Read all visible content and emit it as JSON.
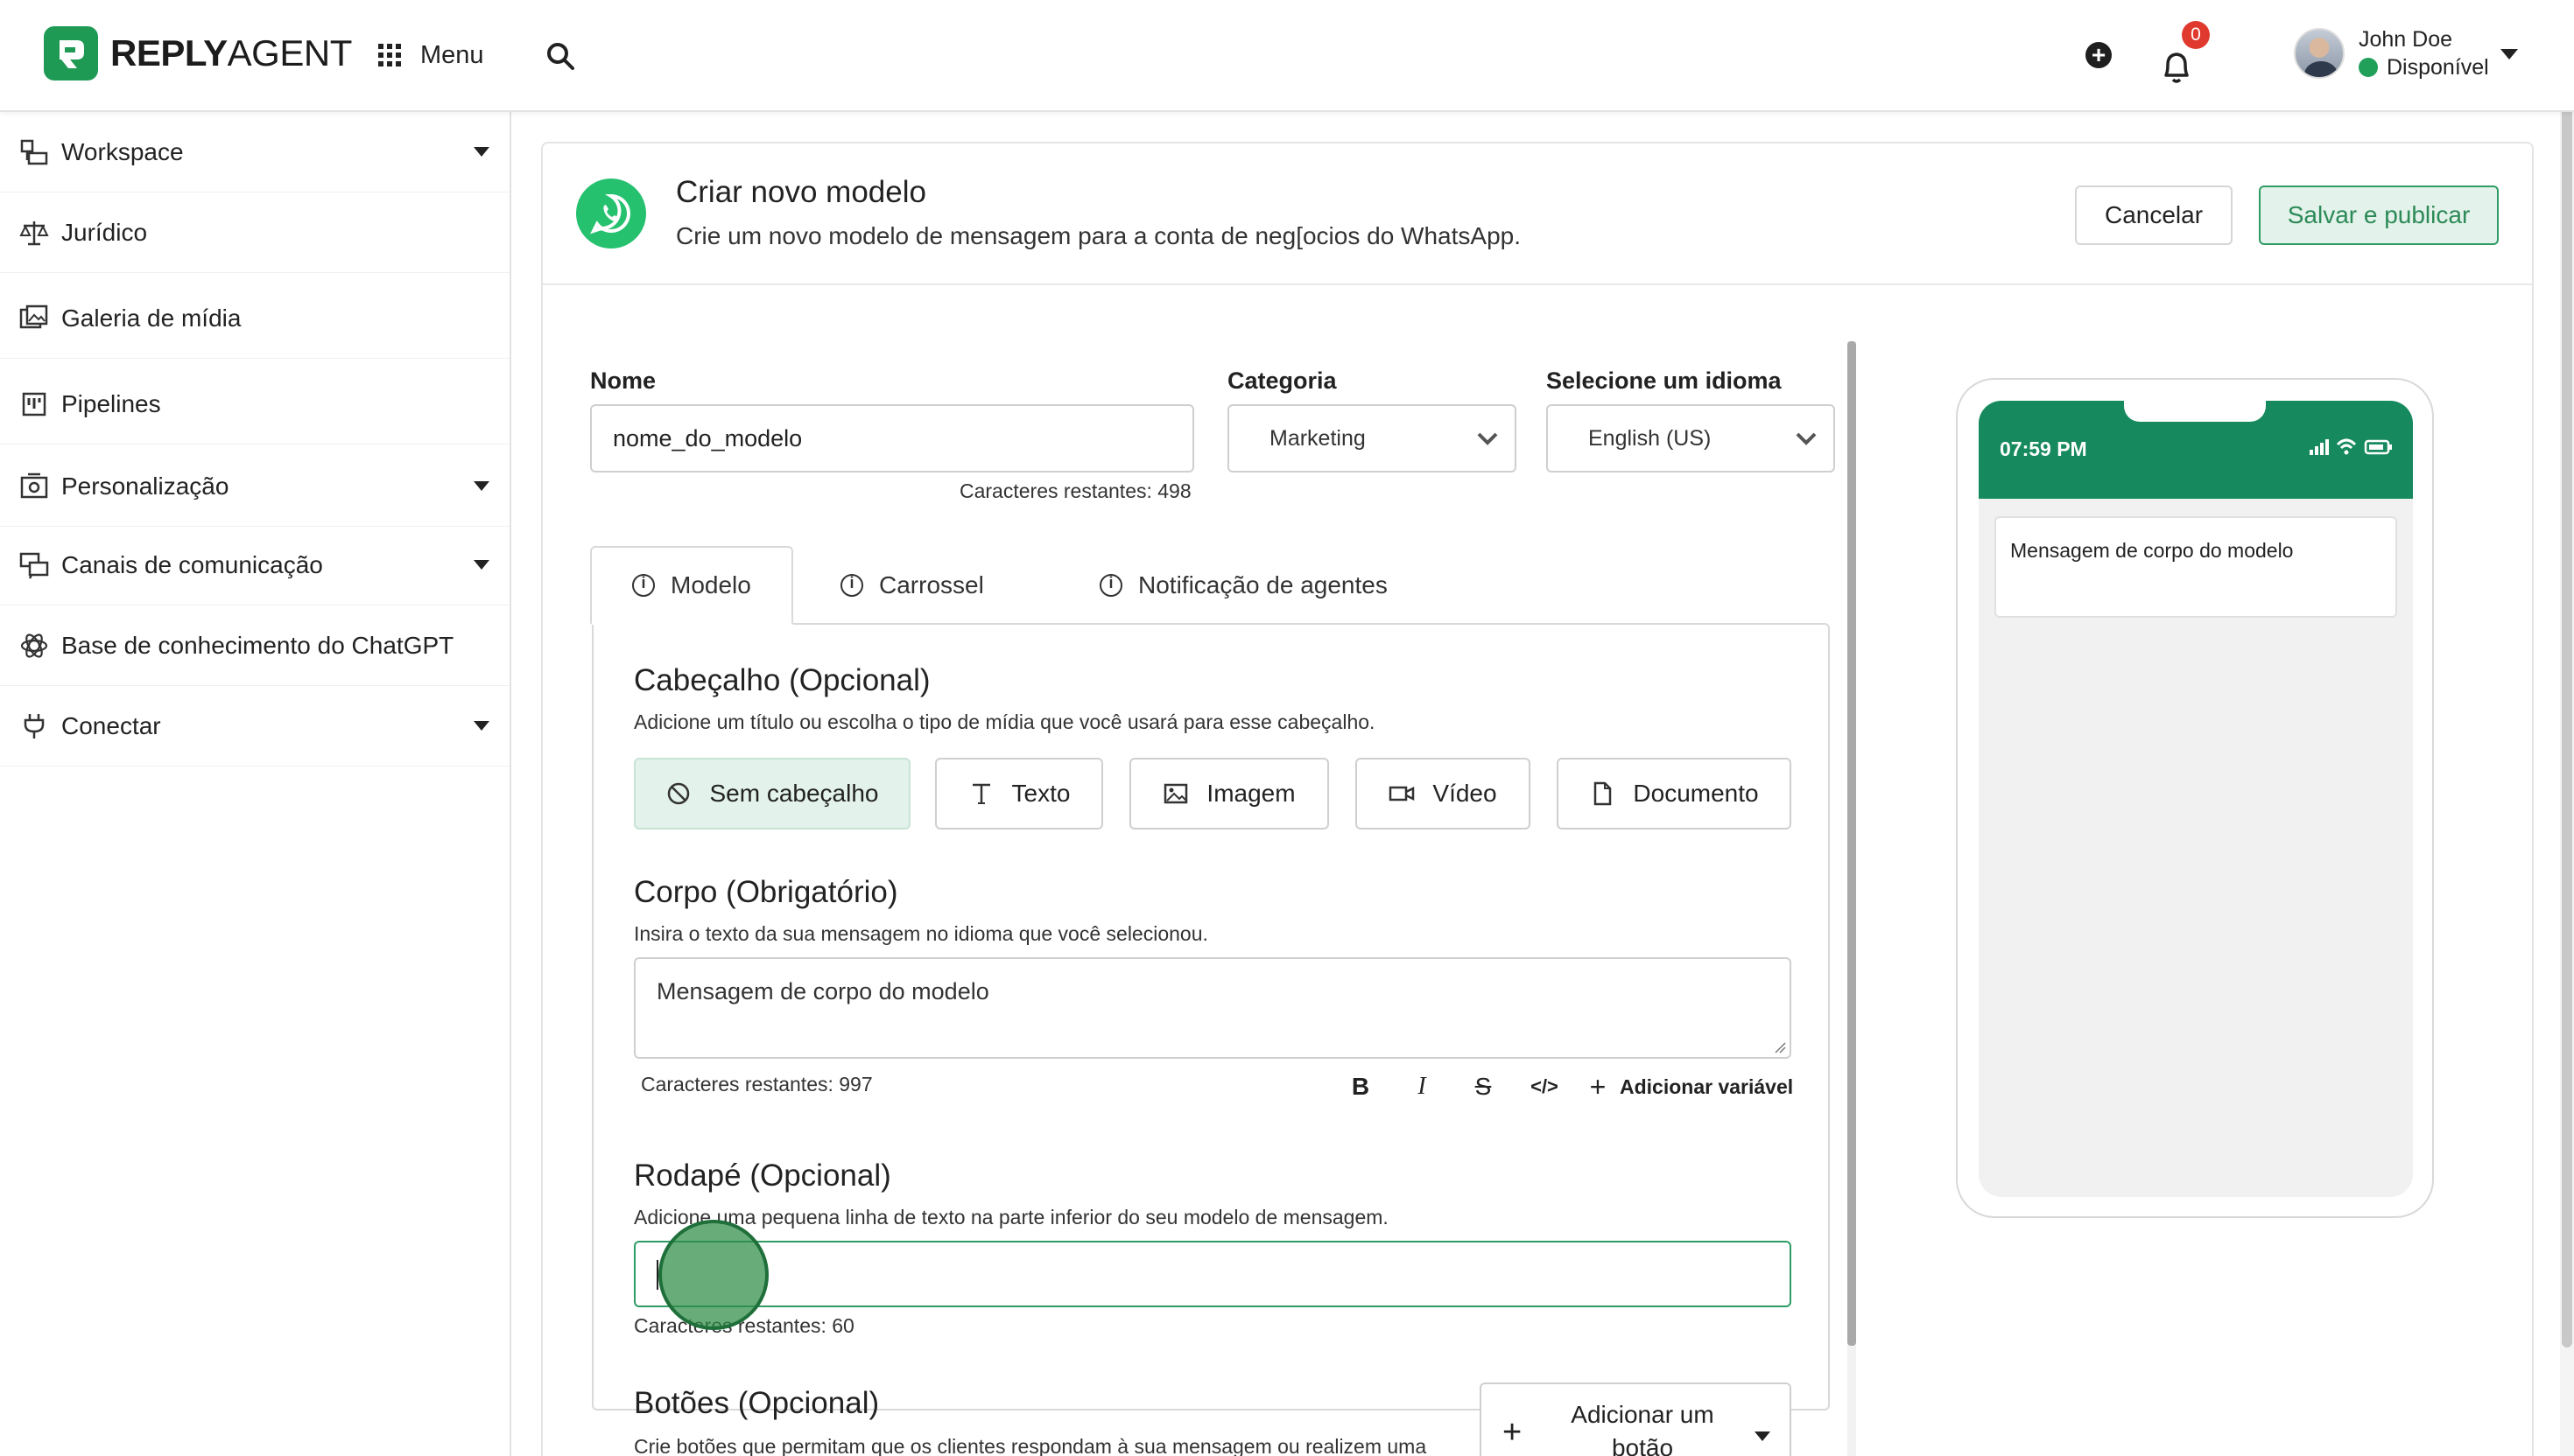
{
  "brand": {
    "logo_bold": "REPLY",
    "logo_regular": "AGENT"
  },
  "topbar": {
    "menu_label": "Menu",
    "notification_count": "0",
    "user_name": "John Doe",
    "user_status": "Disponível"
  },
  "sidebar": {
    "items": [
      {
        "label": "Workspace",
        "icon": "workspace-icon",
        "has_caret": true
      },
      {
        "label": "Jurídico",
        "icon": "scale-icon",
        "has_caret": false
      },
      {
        "label": "Galeria de mídia",
        "icon": "media-gallery-icon",
        "has_caret": false
      },
      {
        "label": "Pipelines",
        "icon": "pipeline-icon",
        "has_caret": false
      },
      {
        "label": "Personalização",
        "icon": "customize-icon",
        "has_caret": true
      },
      {
        "label": "Canais de comunicação",
        "icon": "chat-channels-icon",
        "has_caret": true
      },
      {
        "label": "Base de conhecimento do ChatGPT",
        "icon": "openai-icon",
        "has_caret": false
      },
      {
        "label": "Conectar",
        "icon": "plug-icon",
        "has_caret": true
      }
    ]
  },
  "header": {
    "title": "Criar novo modelo",
    "subtitle": "Crie um novo modelo de mensagem para a conta de neg[ocios do WhatsApp.",
    "cancel_label": "Cancelar",
    "save_label": "Salvar e publicar"
  },
  "form": {
    "name_label": "Nome",
    "name_value": "nome_do_modelo",
    "name_counter": "Caracteres restantes: 498",
    "category_label": "Categoria",
    "category_value": "Marketing",
    "language_label": "Selecione um idioma",
    "language_value": "English (US)"
  },
  "tabs": [
    {
      "label": "Modelo",
      "active": true
    },
    {
      "label": "Carrossel",
      "active": false
    },
    {
      "label": "Notificação de agentes",
      "active": false
    }
  ],
  "header_section": {
    "title": "Cabeçalho (Opcional)",
    "description": "Adicione um título ou escolha o tipo de mídia que você usará para esse cabeçalho.",
    "options": [
      {
        "label": "Sem cabeçalho",
        "icon": "no-header-icon",
        "selected": true
      },
      {
        "label": "Texto",
        "icon": "text-icon",
        "selected": false
      },
      {
        "label": "Imagem",
        "icon": "image-icon",
        "selected": false
      },
      {
        "label": "Vídeo",
        "icon": "video-icon",
        "selected": false
      },
      {
        "label": "Documento",
        "icon": "document-icon",
        "selected": false
      }
    ]
  },
  "body_section": {
    "title": "Corpo (Obrigatório)",
    "description": "Insira o texto da sua mensagem no idioma que você selecionou.",
    "value": "Mensagem de corpo do modelo",
    "counter": "Caracteres restantes: 997",
    "toolbar": {
      "bold": "B",
      "italic": "I",
      "strike": "S",
      "code": "</>",
      "add_variable_label": "Adicionar variável"
    }
  },
  "footer_section": {
    "title": "Rodapé (Opcional)",
    "description": "Adicione uma pequena linha de texto na parte inferior do seu modelo de mensagem.",
    "value": "",
    "counter": "Caracteres restantes: 60"
  },
  "buttons_section": {
    "title": "Botões (Opcional)",
    "description": "Crie botões que permitam que os clientes respondam à sua mensagem ou realizem uma",
    "add_button_label": "Adicionar um botão"
  },
  "preview": {
    "time": "07:59 PM",
    "message": "Mensagem de corpo do modelo"
  },
  "colors": {
    "brand_green": "#1f9a55",
    "whatsapp_green": "#25c16f",
    "phone_header": "#168a5e",
    "badge_red": "#e03a2f",
    "active_bg": "#e3f2ea"
  }
}
